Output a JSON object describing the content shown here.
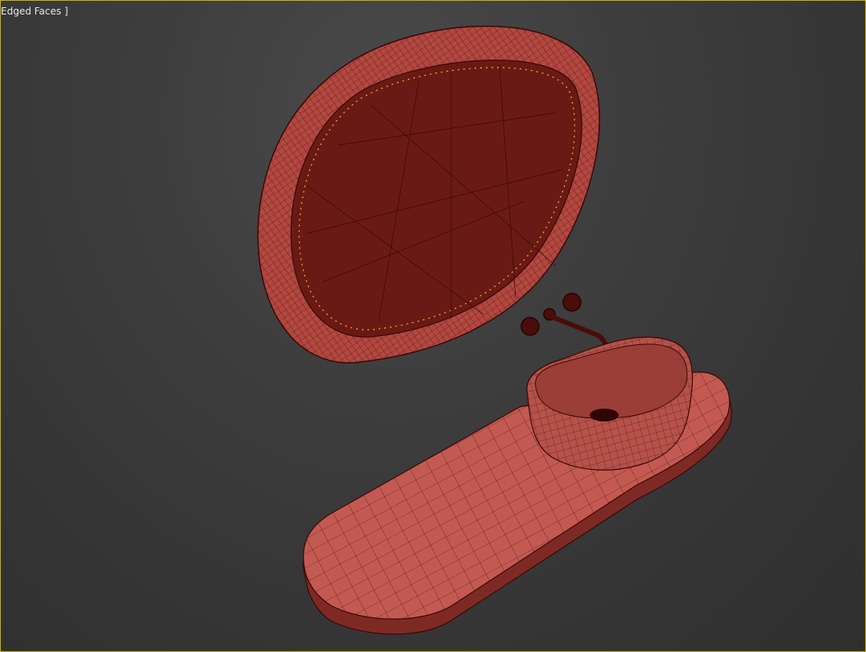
{
  "viewport": {
    "label": "Edged Faces ]",
    "border_color": "#c8b400",
    "background_color": "#3c3c3c"
  },
  "scene": {
    "objects": [
      {
        "name": "oval-mirror",
        "fill": "#6a1a14",
        "rim": "#b84a42",
        "led": "#ffb02a"
      },
      {
        "name": "faucet",
        "fill": "#4a0d09"
      },
      {
        "name": "basin",
        "fill": "#b5524a"
      },
      {
        "name": "countertop",
        "fill": "#c35a52"
      }
    ],
    "wire_color": "#3a0806"
  }
}
